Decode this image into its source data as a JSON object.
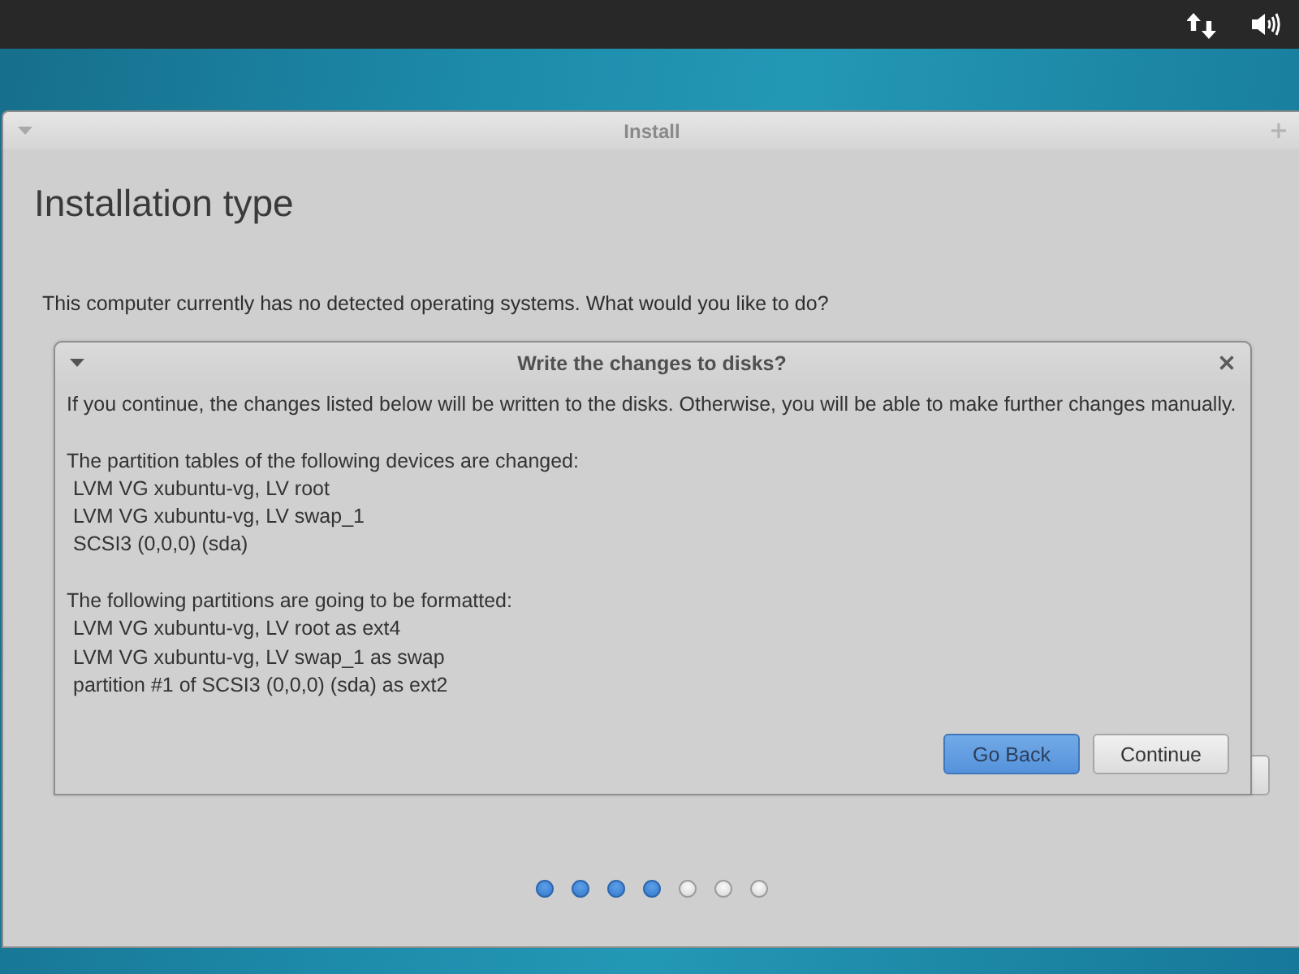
{
  "window": {
    "title": "Install"
  },
  "page": {
    "heading": "Installation type",
    "question": "This computer currently has no detected operating systems. What would you like to do?"
  },
  "dialog": {
    "title": "Write the changes to disks?",
    "intro": "If you continue, the changes listed below will be written to the disks. Otherwise, you will be able to make further changes manually.",
    "sections": [
      {
        "heading": "The partition tables of the following devices are changed:",
        "items": [
          "LVM VG xubuntu-vg, LV root",
          "LVM VG xubuntu-vg, LV swap_1",
          "SCSI3 (0,0,0) (sda)"
        ]
      },
      {
        "heading": "The following partitions are going to be formatted:",
        "items": [
          "LVM VG xubuntu-vg, LV root as ext4",
          "LVM VG xubuntu-vg, LV swap_1 as swap",
          "partition #1 of SCSI3 (0,0,0) (sda) as ext2"
        ]
      }
    ],
    "buttons": [
      {
        "label": "Go Back",
        "focused": true
      },
      {
        "label": "Continue",
        "focused": false
      }
    ]
  },
  "progress_steps": [
    {
      "completed": true
    },
    {
      "completed": true
    },
    {
      "completed": true
    },
    {
      "completed": true
    },
    {
      "completed": false
    },
    {
      "completed": false
    },
    {
      "completed": false
    }
  ]
}
